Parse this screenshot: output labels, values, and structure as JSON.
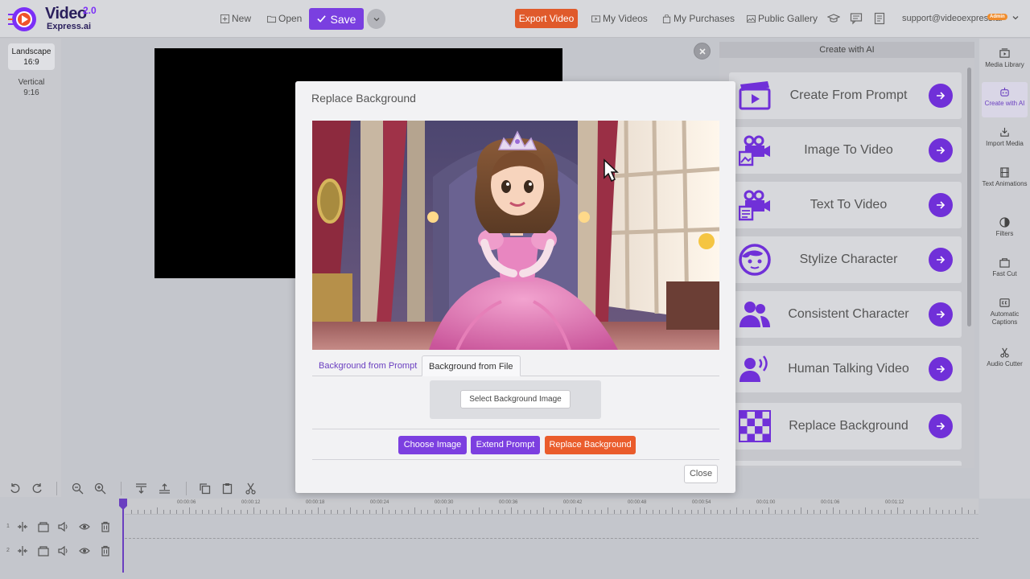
{
  "app": {
    "brand_line1": "Video",
    "brand_line2": "Express.ai",
    "version": "2.0"
  },
  "topbar": {
    "new_label": "New",
    "open_label": "Open",
    "save_label": "Save",
    "export_label": "Export Video",
    "my_videos_label": "My Videos",
    "my_purchases_label": "My Purchases",
    "public_gallery_label": "Public Gallery",
    "user_email": "support@videoexpress.ai",
    "user_badge": "Admin"
  },
  "formats": [
    {
      "name": "Landscape",
      "ratio": "16:9"
    },
    {
      "name": "Vertical",
      "ratio": "9:16"
    }
  ],
  "ai_panel": {
    "title": "Create with AI",
    "cards": [
      {
        "label": "Create From Prompt",
        "icon": "clapperboard-icon"
      },
      {
        "label": "Image To Video",
        "icon": "camera-image-icon"
      },
      {
        "label": "Text To Video",
        "icon": "camera-text-icon"
      },
      {
        "label": "Stylize Character",
        "icon": "character-face-icon"
      },
      {
        "label": "Consistent Character",
        "icon": "users-icon"
      },
      {
        "label": "Human Talking Video",
        "icon": "talking-user-icon"
      },
      {
        "label": "Replace Background",
        "icon": "checkerboard-icon"
      }
    ]
  },
  "right_sidebar": [
    {
      "label": "Media Library",
      "icon": "media-library-icon"
    },
    {
      "label": "Create with AI",
      "icon": "ai-robot-icon",
      "active": true
    },
    {
      "label": "Import Media",
      "icon": "import-icon"
    },
    {
      "label": "Text Animations",
      "icon": "film-icon"
    },
    {
      "label": "Filters",
      "icon": "filter-icon"
    },
    {
      "label": "Fast Cut",
      "icon": "fast-cut-icon"
    },
    {
      "label": "Automatic Captions",
      "icon": "captions-icon"
    },
    {
      "label": "Audio Cutter",
      "icon": "scissors-icon"
    }
  ],
  "timeline": {
    "ticks": [
      "00:00:06",
      "00:00:12",
      "00:00:18",
      "00:00:24",
      "00:00:30",
      "00:00:36",
      "00:00:42",
      "00:00:48",
      "00:00:54",
      "00:01:00",
      "00:01:06",
      "00:01:12"
    ],
    "tracks": [
      "1",
      "2"
    ]
  },
  "modal": {
    "title": "Replace Background",
    "tab_prompt": "Background from Prompt",
    "tab_file": "Background from File",
    "select_bg_label": "Select Background Image",
    "choose_image_label": "Choose Image",
    "extend_prompt_label": "Extend Prompt",
    "replace_bg_label": "Replace Background",
    "close_label": "Close"
  },
  "colors": {
    "accent": "#7a3fe0",
    "export": "#e05a2b",
    "admin_badge": "#f08c2c"
  }
}
